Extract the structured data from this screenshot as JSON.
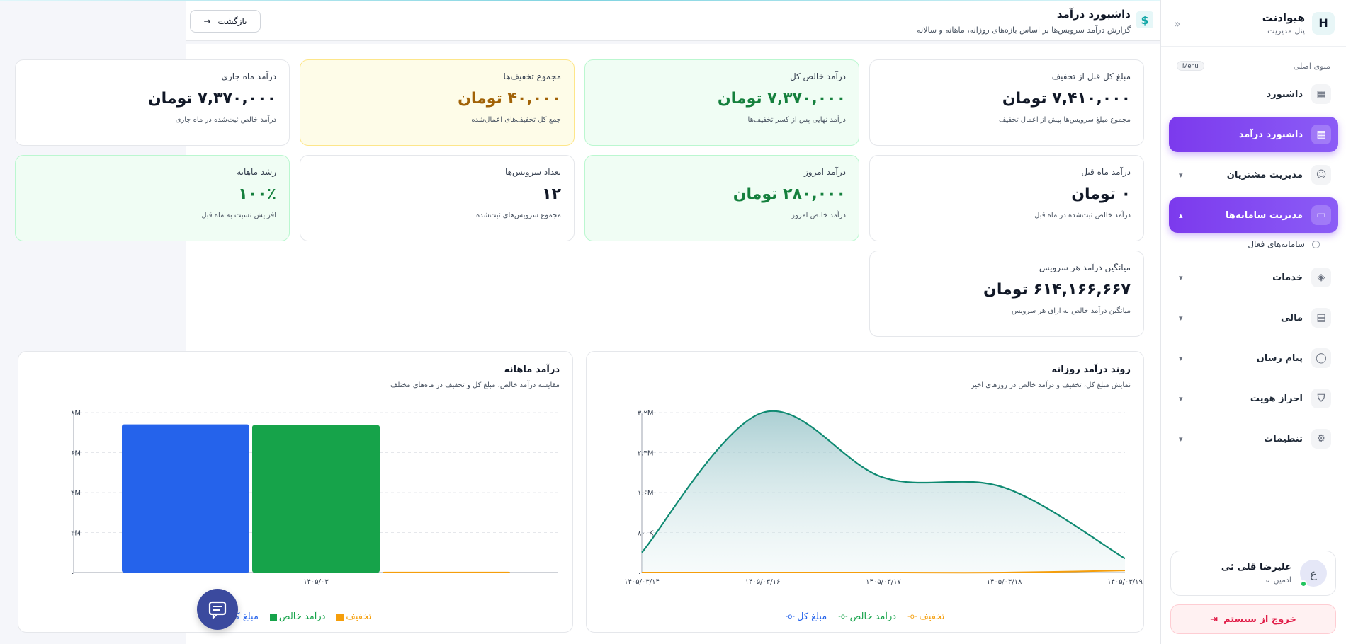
{
  "brand": {
    "name": "هیوادنت",
    "subtitle": "پنل مدیریت",
    "logo": "H"
  },
  "menu": {
    "title": "منوی اصلی",
    "badge": "Menu"
  },
  "nav": {
    "dashboard": "داشبورد",
    "revenue_dashboard": "داشبورد درآمد",
    "customers": "مدیریت مشتریان",
    "systems": "مدیریت سامانه‌ها",
    "active_systems": "سامانه‌های فعال",
    "services": "خدمات",
    "finance": "مالی",
    "messenger": "پیام رسان",
    "identity": "احراز هویت",
    "settings": "تنظیمات"
  },
  "user": {
    "initial": "ع",
    "name": "علیرضا قلی ئی",
    "role": "ادمین"
  },
  "logout_label": "خروج از سیستم",
  "header": {
    "title": "داشبورد درآمد",
    "subtitle": "گزارش درآمد سرویس‌ها بر اساس بازه‌های روزانه، ماهانه و سالانه",
    "back_label": "بازگشت"
  },
  "stats": {
    "gross": {
      "title": "مبلغ کل قبل از تخفیف",
      "value": "۷,۴۱۰,۰۰۰ تومان",
      "desc": "مجموع مبلغ سرویس‌ها پیش از اعمال تخفیف"
    },
    "net": {
      "title": "درآمد خالص کل",
      "value": "۷,۳۷۰,۰۰۰ تومان",
      "desc": "درآمد نهایی پس از کسر تخفیف‌ها"
    },
    "discounts": {
      "title": "مجموع تخفیف‌ها",
      "value": "۴۰,۰۰۰ تومان",
      "desc": "جمع کل تخفیف‌های اعمال‌شده"
    },
    "current_month": {
      "title": "درآمد ماه جاری",
      "value": "۷,۳۷۰,۰۰۰ تومان",
      "desc": "درآمد خالص ثبت‌شده در ماه جاری"
    },
    "last_month": {
      "title": "درآمد ماه قبل",
      "value": "۰ تومان",
      "desc": "درآمد خالص ثبت‌شده در ماه قبل"
    },
    "today": {
      "title": "درآمد امروز",
      "value": "۲۸۰,۰۰۰ تومان",
      "desc": "درآمد خالص امروز"
    },
    "services_count": {
      "title": "تعداد سرویس‌ها",
      "value": "۱۲",
      "desc": "مجموع سرویس‌های ثبت‌شده"
    },
    "growth": {
      "title": "رشد ماهانه",
      "value": "۱۰۰٪",
      "desc": "افزایش نسبت به ماه قبل"
    },
    "average": {
      "title": "میانگین درآمد هر سرویس",
      "value": "۶۱۴,۱۶۶,۶۶۷ تومان",
      "desc": "میانگین درآمد خالص به ازای هر سرویس"
    }
  },
  "colors": {
    "gross": "#2563eb",
    "net": "#16a34a",
    "discount": "#f59e0b",
    "area": "#0f8a72",
    "accent": "#7c3aed"
  },
  "daily_chart": {
    "title": "روند درآمد روزانه",
    "subtitle": "نمایش مبلغ کل، تخفیف و درآمد خالص در روزهای اخیر"
  },
  "monthly_chart": {
    "title": "درآمد ماهانه",
    "subtitle": "مقایسه درآمد خالص، مبلغ کل و تخفیف در ماه‌های مختلف"
  },
  "chart_data": [
    {
      "type": "area",
      "title": "روند درآمد روزانه",
      "x": [
        "۱۴۰۵/۰۳/۱۴",
        "۱۴۰۵/۰۳/۱۶",
        "۱۴۰۵/۰۳/۱۷",
        "۱۴۰۵/۰۳/۱۸",
        "۱۴۰۵/۰۳/۱۹"
      ],
      "ytick_labels": [
        "۰",
        "۸۰۰K",
        "۱.۶M",
        "۲.۴M",
        "۳.۲M"
      ],
      "ylim": [
        0,
        3200000
      ],
      "series": [
        {
          "name": "مبلغ کل",
          "values": [
            400000,
            3200000,
            1900000,
            1700000,
            300000
          ]
        },
        {
          "name": "درآمد خالص",
          "values": [
            400000,
            3200000,
            1900000,
            1700000,
            280000
          ]
        },
        {
          "name": "تخفیف",
          "values": [
            0,
            0,
            0,
            0,
            40000
          ]
        }
      ]
    },
    {
      "type": "bar",
      "title": "درآمد ماهانه",
      "categories": [
        "۱۴۰۵/۰۳"
      ],
      "ytick_labels": [
        "۰",
        "۲M",
        "۴M",
        "۶M",
        "۸M"
      ],
      "ylim": [
        0,
        8000000
      ],
      "series": [
        {
          "name": "مبلغ کل",
          "values": [
            7410000
          ]
        },
        {
          "name": "درآمد خالص",
          "values": [
            7370000
          ]
        },
        {
          "name": "تخفیف",
          "values": [
            40000
          ]
        }
      ]
    }
  ]
}
